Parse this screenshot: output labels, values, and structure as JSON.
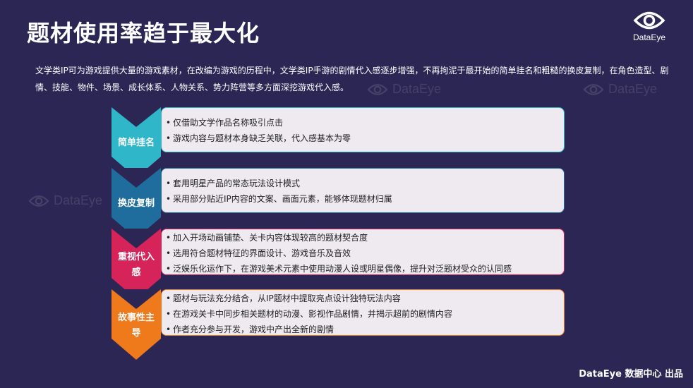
{
  "title": "题材使用率趋于最大化",
  "logo": {
    "text": "DataEye",
    "icon": "eye-icon"
  },
  "intro": "文学类IP可为游戏提供大量的游戏素材，在改编为游戏的历程中，文学类IP手游的剧情代入感逐步增强，不再拘泥于最开始的简单挂名和粗糙的换皮复制，在角色造型、剧情、技能、物件、场景、成长体系、人物关系、势力阵营等多方面深挖游戏代入感。",
  "watermark_text": "DataEye",
  "steps": [
    {
      "label": "简单挂名",
      "color": "#2fb6c9",
      "items": [
        "仅借助文学作品名称吸引点击",
        "游戏内容与题材本身缺乏关联，代入感基本为零"
      ]
    },
    {
      "label": "换皮复制",
      "color": "#1f6d9c",
      "items": [
        "套用明星产品的常态玩法设计模式",
        "采用部分贴近IP内容的文案、画面元素，能够体现题材归属"
      ]
    },
    {
      "label": "重视代入感",
      "label_lines": [
        "重视代入",
        "感"
      ],
      "color": "#d6245a",
      "items": [
        "加入开场动画铺垫、关卡内容体现较高的题材契合度",
        "选用符合题材特征的界面设计、游戏音乐及音效",
        "泛娱乐化运作下，在游戏美术元素中使用动漫人设或明星偶像，提升对泛题材受众的认同感"
      ]
    },
    {
      "label": "故事性主导",
      "label_lines": [
        "故事性主",
        "导"
      ],
      "color": "#ee7a1c",
      "items": [
        "题材与玩法充分结合，从IP题材中提取亮点设计独特玩法内容",
        "在游戏关卡中同步相关题材的动漫、影视作品剧情，并揭示超前的剧情内容",
        "作者充分参与开发，游戏中产出全新的剧情"
      ]
    }
  ],
  "footer": "DataEye 数据中心 出品"
}
